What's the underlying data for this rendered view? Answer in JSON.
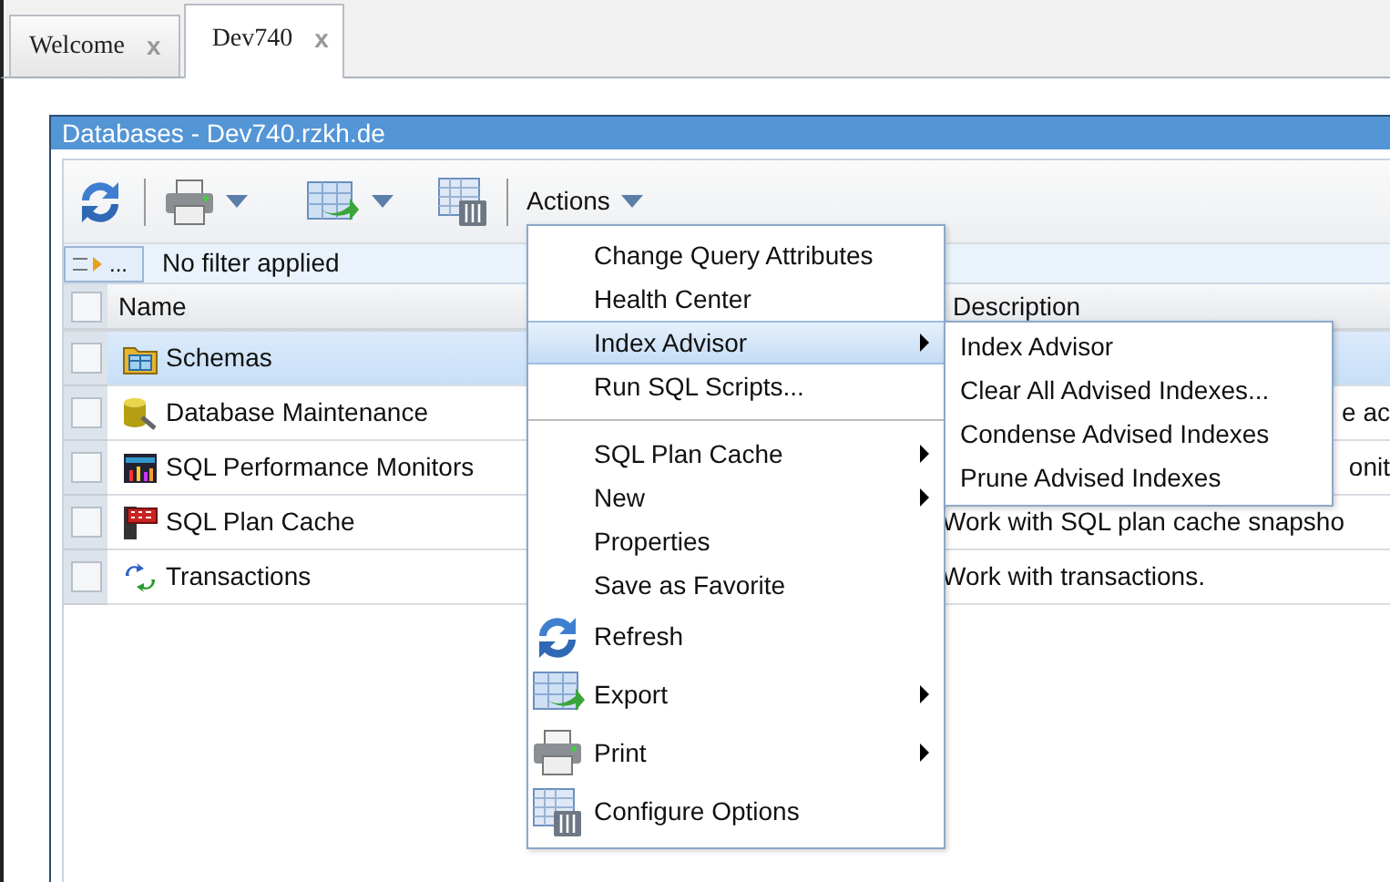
{
  "tabs": [
    {
      "label": "Welcome",
      "close": "x",
      "selected": false
    },
    {
      "label": "Dev740",
      "close": "x",
      "selected": true
    }
  ],
  "panel": {
    "title": "Databases - Dev740.rzkh.de",
    "toolbar": {
      "actions_label": "Actions"
    },
    "filter": {
      "button": "...",
      "text": "No filter applied"
    },
    "table": {
      "select_all_checked": false,
      "columns": [
        "Name",
        "Description"
      ],
      "rows": [
        {
          "kind": "schema",
          "name": "Schemas",
          "description": "",
          "selected": true,
          "checked": false
        },
        {
          "kind": "maintenance",
          "name": "Database Maintenance",
          "description": "e ac",
          "selected": false,
          "checked": false
        },
        {
          "kind": "monitor",
          "name": "SQL Performance Monitors",
          "description": "onit",
          "selected": false,
          "checked": false
        },
        {
          "kind": "plancache",
          "name": "SQL Plan Cache",
          "description": "Work with SQL plan cache snapsho",
          "selected": false,
          "checked": false
        },
        {
          "kind": "transaction",
          "name": "Transactions",
          "description": "Work with transactions.",
          "selected": false,
          "checked": false
        }
      ]
    }
  },
  "context_menu": {
    "items": [
      {
        "kind": "plain",
        "label": "Change Query Attributes",
        "submenu": false,
        "selected": false
      },
      {
        "kind": "plain",
        "label": "Health Center",
        "submenu": false,
        "selected": false
      },
      {
        "kind": "plain",
        "label": "Index Advisor",
        "submenu": true,
        "selected": true
      },
      {
        "kind": "plain",
        "label": "Run SQL Scripts...",
        "submenu": false,
        "selected": false
      },
      {
        "kind": "separator"
      },
      {
        "kind": "plain",
        "label": "SQL Plan Cache",
        "submenu": true,
        "selected": false
      },
      {
        "kind": "plain",
        "label": "New",
        "submenu": true,
        "selected": false
      },
      {
        "kind": "plain",
        "label": "Properties",
        "submenu": false,
        "selected": false
      },
      {
        "kind": "plain",
        "label": "Save as Favorite",
        "submenu": false,
        "selected": false
      },
      {
        "kind": "refresh",
        "label": "Refresh",
        "submenu": false,
        "selected": false
      },
      {
        "kind": "export",
        "label": "Export",
        "submenu": true,
        "selected": false
      },
      {
        "kind": "print",
        "label": "Print",
        "submenu": true,
        "selected": false
      },
      {
        "kind": "configure",
        "label": "Configure Options",
        "submenu": false,
        "selected": false
      }
    ],
    "submenu": [
      "Index Advisor",
      "Clear All Advised Indexes...",
      "Condense Advised Indexes",
      "Prune Advised Indexes"
    ]
  }
}
